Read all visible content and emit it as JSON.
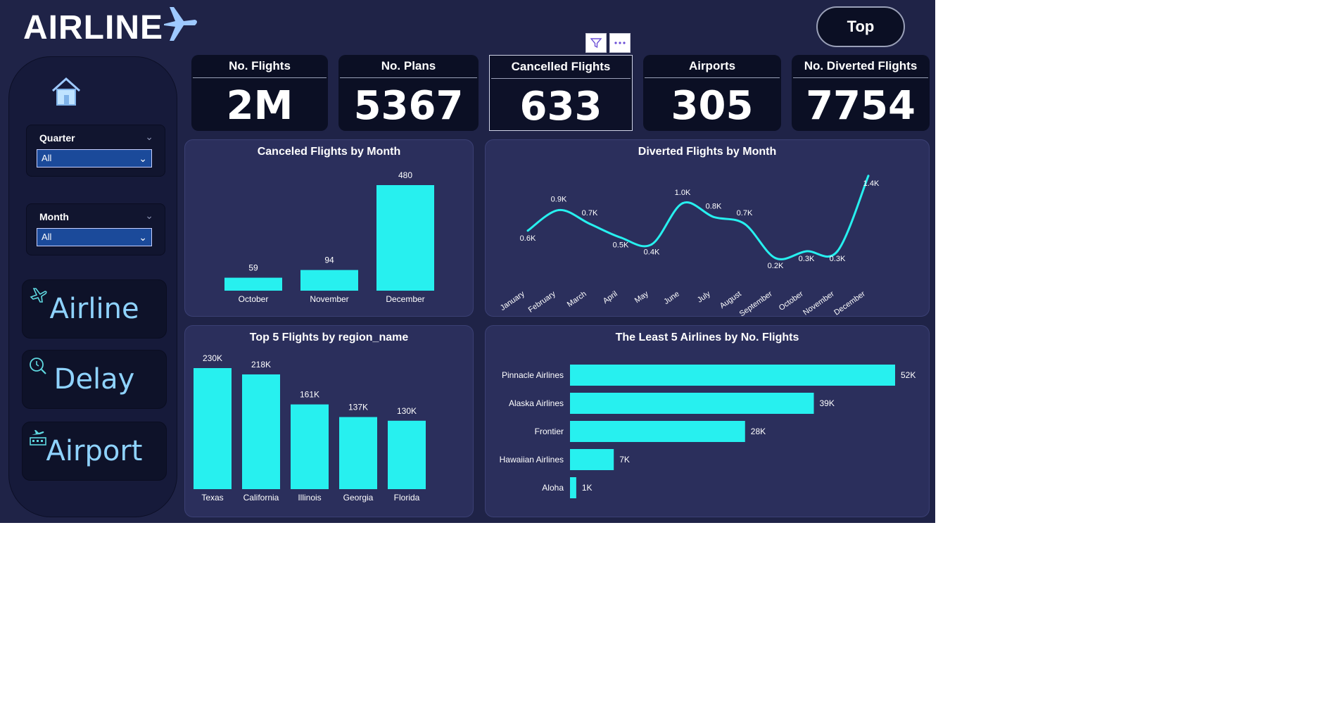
{
  "header": {
    "title": "AIRLINE",
    "top_button": "Top"
  },
  "filters": [
    {
      "label": "Quarter",
      "value": "All"
    },
    {
      "label": "Month",
      "value": "All"
    }
  ],
  "nav": [
    {
      "label": "Airline",
      "icon": "plane-outline-icon"
    },
    {
      "label": "Delay",
      "icon": "clock-search-icon"
    },
    {
      "label": "Airport",
      "icon": "airport-icon"
    }
  ],
  "kpis": [
    {
      "label": "No. Flights",
      "value": "2M"
    },
    {
      "label": "No. Plans",
      "value": "5367"
    },
    {
      "label": "Cancelled Flights",
      "value": "633"
    },
    {
      "label": "Airports",
      "value": "305"
    },
    {
      "label": "No. Diverted Flights",
      "value": "7754"
    }
  ],
  "colors": {
    "bar": "#27f0ef",
    "background": "#1f2347",
    "panel": "#2b2f5c"
  },
  "chart_data": [
    {
      "type": "bar",
      "title": "Canceled Flights by Month",
      "categories": [
        "October",
        "November",
        "December"
      ],
      "values": [
        59,
        94,
        480
      ],
      "labels": [
        "59",
        "94",
        "480"
      ]
    },
    {
      "type": "line",
      "title": "Diverted Flights by Month",
      "categories": [
        "January",
        "February",
        "March",
        "April",
        "May",
        "June",
        "July",
        "August",
        "September",
        "October",
        "November",
        "December"
      ],
      "values": [
        0.6,
        0.9,
        0.7,
        0.5,
        0.4,
        1.0,
        0.8,
        0.7,
        0.2,
        0.3,
        0.3,
        1.4
      ],
      "labels": [
        "0.6K",
        "0.9K",
        "0.7K",
        "0.5K",
        "0.4K",
        "1.0K",
        "0.8K",
        "0.7K",
        "0.2K",
        "0.3K",
        "0.3K",
        "1.4K"
      ]
    },
    {
      "type": "bar",
      "title": "Top 5 Flights by region_name",
      "categories": [
        "Texas",
        "California",
        "Illinois",
        "Georgia",
        "Florida"
      ],
      "values": [
        230,
        218,
        161,
        137,
        130
      ],
      "labels": [
        "230K",
        "218K",
        "161K",
        "137K",
        "130K"
      ]
    },
    {
      "type": "bar",
      "orientation": "horizontal",
      "title": "The Least 5 Airlines by No. Flights",
      "categories": [
        "Pinnacle Airlines",
        "Alaska Airlines",
        "Frontier",
        "Hawaiian Airlines",
        "Aloha"
      ],
      "values": [
        52,
        39,
        28,
        7,
        1
      ],
      "labels": [
        "52K",
        "39K",
        "28K",
        "7K",
        "1K"
      ]
    }
  ]
}
